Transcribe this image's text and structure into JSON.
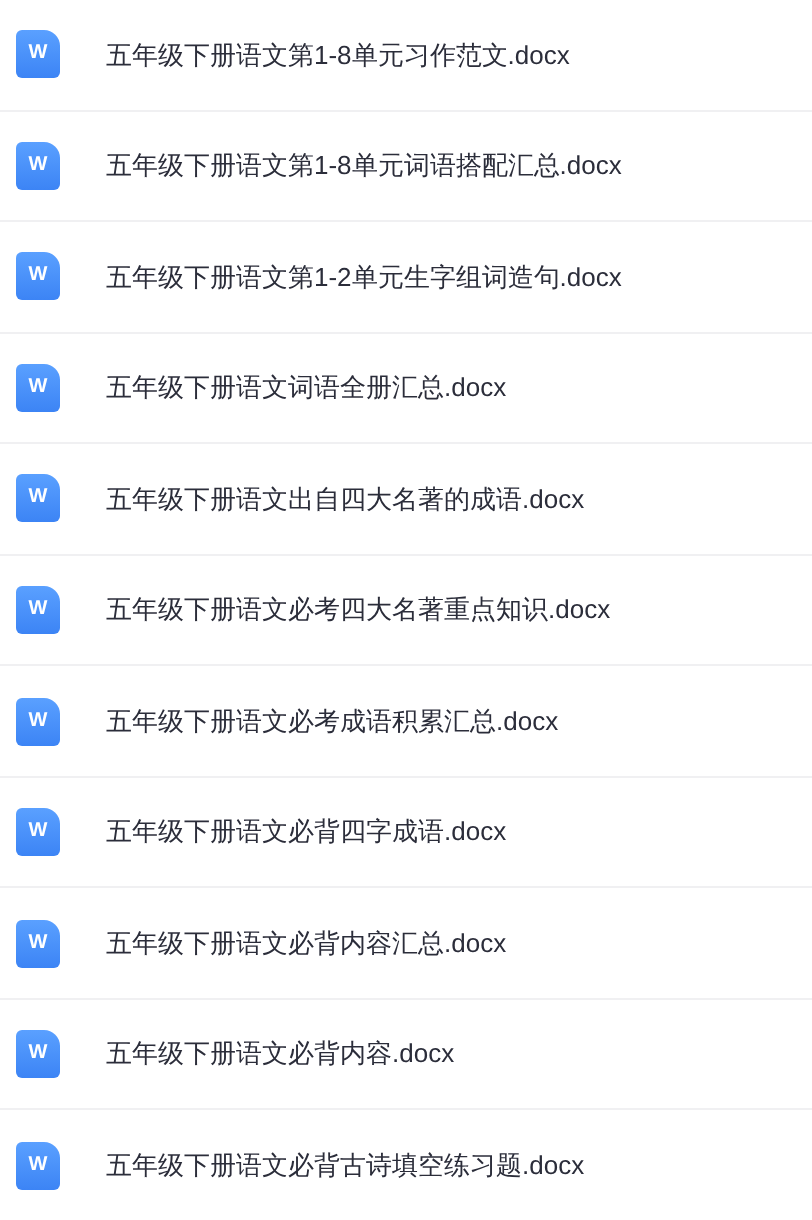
{
  "files": [
    {
      "name": "五年级下册语文第1-8单元习作范文.docx",
      "icon_text": "W"
    },
    {
      "name": "五年级下册语文第1-8单元词语搭配汇总.docx",
      "icon_text": "W"
    },
    {
      "name": "五年级下册语文第1-2单元生字组词造句.docx",
      "icon_text": "W"
    },
    {
      "name": "五年级下册语文词语全册汇总.docx",
      "icon_text": "W"
    },
    {
      "name": "五年级下册语文出自四大名著的成语.docx",
      "icon_text": "W"
    },
    {
      "name": "五年级下册语文必考四大名著重点知识.docx",
      "icon_text": "W"
    },
    {
      "name": "五年级下册语文必考成语积累汇总.docx",
      "icon_text": "W"
    },
    {
      "name": "五年级下册语文必背四字成语.docx",
      "icon_text": "W"
    },
    {
      "name": "五年级下册语文必背内容汇总.docx",
      "icon_text": "W"
    },
    {
      "name": "五年级下册语文必背内容.docx",
      "icon_text": "W"
    },
    {
      "name": "五年级下册语文必背古诗填空练习题.docx",
      "icon_text": "W"
    }
  ]
}
